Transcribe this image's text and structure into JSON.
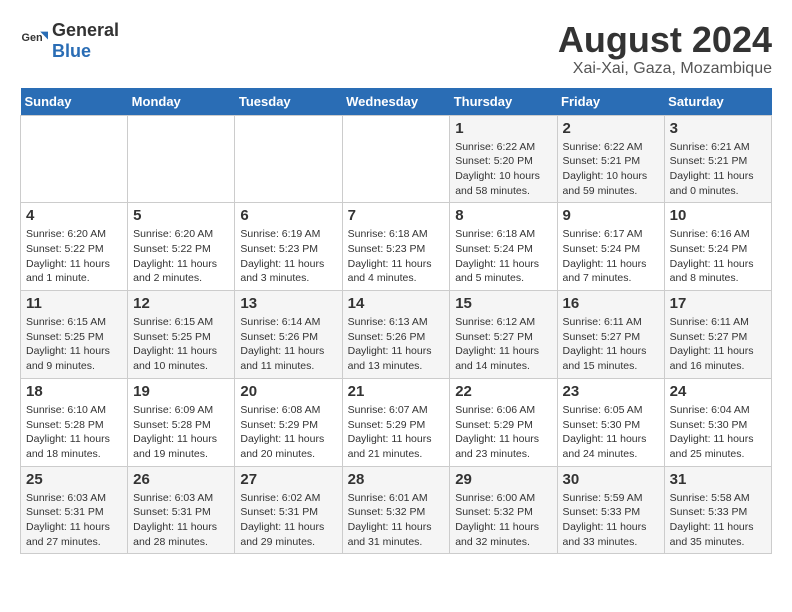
{
  "header": {
    "logo_general": "General",
    "logo_blue": "Blue",
    "title": "August 2024",
    "subtitle": "Xai-Xai, Gaza, Mozambique"
  },
  "weekdays": [
    "Sunday",
    "Monday",
    "Tuesday",
    "Wednesday",
    "Thursday",
    "Friday",
    "Saturday"
  ],
  "weeks": [
    [
      {
        "day": "",
        "info": ""
      },
      {
        "day": "",
        "info": ""
      },
      {
        "day": "",
        "info": ""
      },
      {
        "day": "",
        "info": ""
      },
      {
        "day": "1",
        "info": "Sunrise: 6:22 AM\nSunset: 5:20 PM\nDaylight: 10 hours\nand 58 minutes."
      },
      {
        "day": "2",
        "info": "Sunrise: 6:22 AM\nSunset: 5:21 PM\nDaylight: 10 hours\nand 59 minutes."
      },
      {
        "day": "3",
        "info": "Sunrise: 6:21 AM\nSunset: 5:21 PM\nDaylight: 11 hours\nand 0 minutes."
      }
    ],
    [
      {
        "day": "4",
        "info": "Sunrise: 6:20 AM\nSunset: 5:22 PM\nDaylight: 11 hours\nand 1 minute."
      },
      {
        "day": "5",
        "info": "Sunrise: 6:20 AM\nSunset: 5:22 PM\nDaylight: 11 hours\nand 2 minutes."
      },
      {
        "day": "6",
        "info": "Sunrise: 6:19 AM\nSunset: 5:23 PM\nDaylight: 11 hours\nand 3 minutes."
      },
      {
        "day": "7",
        "info": "Sunrise: 6:18 AM\nSunset: 5:23 PM\nDaylight: 11 hours\nand 4 minutes."
      },
      {
        "day": "8",
        "info": "Sunrise: 6:18 AM\nSunset: 5:24 PM\nDaylight: 11 hours\nand 5 minutes."
      },
      {
        "day": "9",
        "info": "Sunrise: 6:17 AM\nSunset: 5:24 PM\nDaylight: 11 hours\nand 7 minutes."
      },
      {
        "day": "10",
        "info": "Sunrise: 6:16 AM\nSunset: 5:24 PM\nDaylight: 11 hours\nand 8 minutes."
      }
    ],
    [
      {
        "day": "11",
        "info": "Sunrise: 6:15 AM\nSunset: 5:25 PM\nDaylight: 11 hours\nand 9 minutes."
      },
      {
        "day": "12",
        "info": "Sunrise: 6:15 AM\nSunset: 5:25 PM\nDaylight: 11 hours\nand 10 minutes."
      },
      {
        "day": "13",
        "info": "Sunrise: 6:14 AM\nSunset: 5:26 PM\nDaylight: 11 hours\nand 11 minutes."
      },
      {
        "day": "14",
        "info": "Sunrise: 6:13 AM\nSunset: 5:26 PM\nDaylight: 11 hours\nand 13 minutes."
      },
      {
        "day": "15",
        "info": "Sunrise: 6:12 AM\nSunset: 5:27 PM\nDaylight: 11 hours\nand 14 minutes."
      },
      {
        "day": "16",
        "info": "Sunrise: 6:11 AM\nSunset: 5:27 PM\nDaylight: 11 hours\nand 15 minutes."
      },
      {
        "day": "17",
        "info": "Sunrise: 6:11 AM\nSunset: 5:27 PM\nDaylight: 11 hours\nand 16 minutes."
      }
    ],
    [
      {
        "day": "18",
        "info": "Sunrise: 6:10 AM\nSunset: 5:28 PM\nDaylight: 11 hours\nand 18 minutes."
      },
      {
        "day": "19",
        "info": "Sunrise: 6:09 AM\nSunset: 5:28 PM\nDaylight: 11 hours\nand 19 minutes."
      },
      {
        "day": "20",
        "info": "Sunrise: 6:08 AM\nSunset: 5:29 PM\nDaylight: 11 hours\nand 20 minutes."
      },
      {
        "day": "21",
        "info": "Sunrise: 6:07 AM\nSunset: 5:29 PM\nDaylight: 11 hours\nand 21 minutes."
      },
      {
        "day": "22",
        "info": "Sunrise: 6:06 AM\nSunset: 5:29 PM\nDaylight: 11 hours\nand 23 minutes."
      },
      {
        "day": "23",
        "info": "Sunrise: 6:05 AM\nSunset: 5:30 PM\nDaylight: 11 hours\nand 24 minutes."
      },
      {
        "day": "24",
        "info": "Sunrise: 6:04 AM\nSunset: 5:30 PM\nDaylight: 11 hours\nand 25 minutes."
      }
    ],
    [
      {
        "day": "25",
        "info": "Sunrise: 6:03 AM\nSunset: 5:31 PM\nDaylight: 11 hours\nand 27 minutes."
      },
      {
        "day": "26",
        "info": "Sunrise: 6:03 AM\nSunset: 5:31 PM\nDaylight: 11 hours\nand 28 minutes."
      },
      {
        "day": "27",
        "info": "Sunrise: 6:02 AM\nSunset: 5:31 PM\nDaylight: 11 hours\nand 29 minutes."
      },
      {
        "day": "28",
        "info": "Sunrise: 6:01 AM\nSunset: 5:32 PM\nDaylight: 11 hours\nand 31 minutes."
      },
      {
        "day": "29",
        "info": "Sunrise: 6:00 AM\nSunset: 5:32 PM\nDaylight: 11 hours\nand 32 minutes."
      },
      {
        "day": "30",
        "info": "Sunrise: 5:59 AM\nSunset: 5:33 PM\nDaylight: 11 hours\nand 33 minutes."
      },
      {
        "day": "31",
        "info": "Sunrise: 5:58 AM\nSunset: 5:33 PM\nDaylight: 11 hours\nand 35 minutes."
      }
    ]
  ]
}
